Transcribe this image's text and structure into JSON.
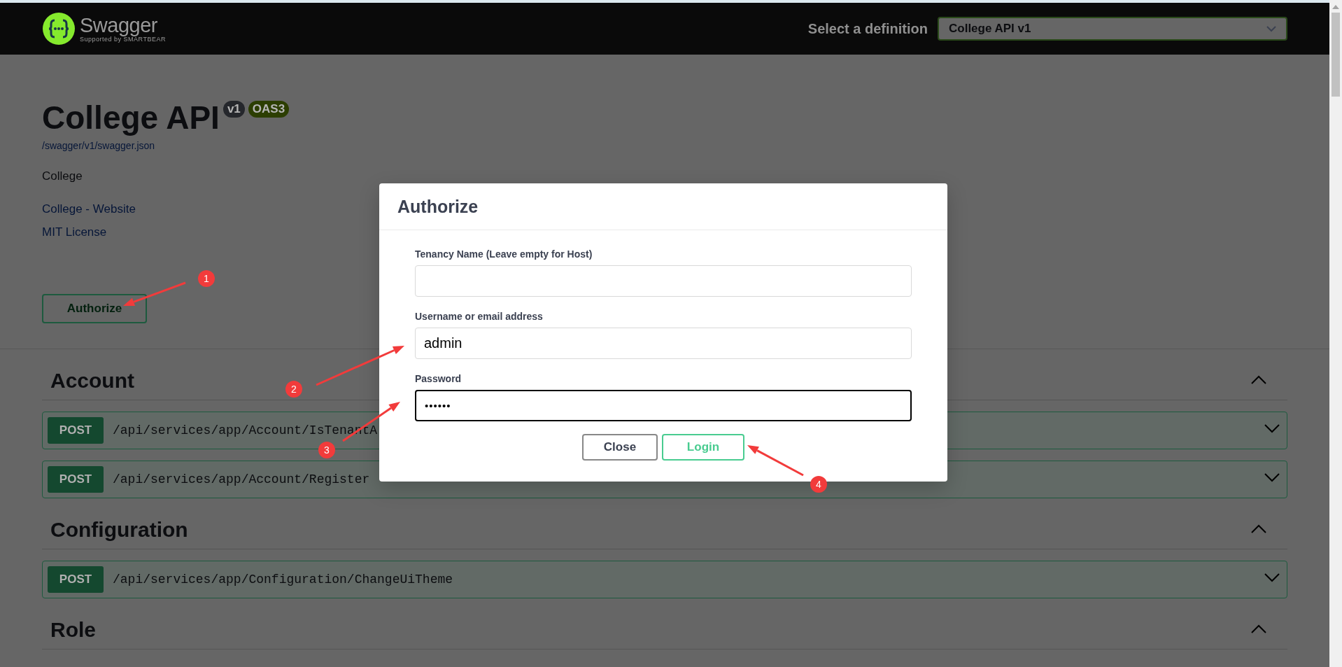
{
  "topbar": {
    "logo_title": "Swagger",
    "logo_subtitle": "Supported by SMARTBEAR",
    "definition_label": "Select a definition",
    "definition_value": "College API v1"
  },
  "info": {
    "title": "College API",
    "version": "v1",
    "spec": "OAS3",
    "spec_url": "/swagger/v1/swagger.json",
    "description": "College",
    "links": [
      "College - Website",
      "MIT License"
    ]
  },
  "authorize_button": "Authorize",
  "sections": [
    {
      "name": "Account",
      "expanded": true,
      "operations": [
        {
          "method": "POST",
          "path": "/api/services/app/Account/IsTenantA",
          "expanded": false
        },
        {
          "method": "POST",
          "path": "/api/services/app/Account/Register",
          "expanded": false
        }
      ]
    },
    {
      "name": "Configuration",
      "expanded": true,
      "operations": [
        {
          "method": "POST",
          "path": "/api/services/app/Configuration/ChangeUiTheme",
          "expanded": false
        }
      ]
    },
    {
      "name": "Role",
      "expanded": true
    }
  ],
  "modal": {
    "title": "Authorize",
    "fields": [
      {
        "label": "Tenancy Name (Leave empty for Host)",
        "kind": "text",
        "focused": false
      },
      {
        "label": "Username or email address",
        "value": "admin",
        "kind": "text",
        "focused": false
      },
      {
        "label": "Password",
        "value": "••••••",
        "kind": "password",
        "focused": true
      }
    ],
    "buttons": [
      {
        "label": "Close",
        "kind": "close"
      },
      {
        "label": "Login",
        "kind": "login"
      }
    ]
  },
  "annotations": [
    {
      "number": "1"
    },
    {
      "number": "2"
    },
    {
      "number": "3"
    },
    {
      "number": "4"
    }
  ]
}
